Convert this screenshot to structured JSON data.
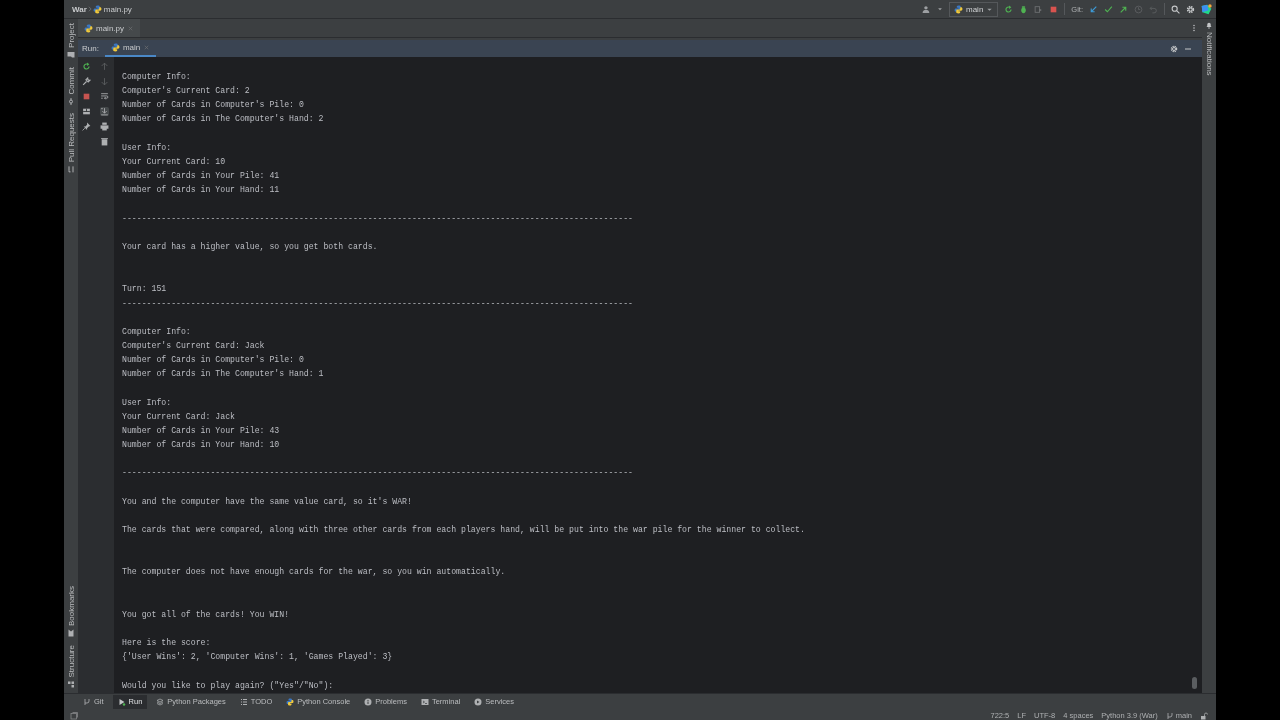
{
  "breadcrumbs": [
    "War",
    "main.py"
  ],
  "toolbar": {
    "run_config": "main",
    "git_label": "Git:"
  },
  "editor_tabs": [
    {
      "label": "main.py",
      "selected": true
    }
  ],
  "left_stripe": {
    "top": [
      "Project",
      "Commit",
      "Pull Requests"
    ],
    "bottom": [
      "Bookmarks",
      "Structure"
    ]
  },
  "right_stripe": [
    "Notifications"
  ],
  "run_panel": {
    "label": "Run:",
    "tabs": [
      {
        "label": "main",
        "selected": true
      }
    ]
  },
  "console": [
    {
      "kind": "text",
      "text": "Computer Info:"
    },
    {
      "kind": "text",
      "text": "Computer's Current Card: 2"
    },
    {
      "kind": "text",
      "text": "Number of Cards in Computer's Pile: 0"
    },
    {
      "kind": "text",
      "text": "Number of Cards in The Computer's Hand: 2"
    },
    {
      "kind": "blank"
    },
    {
      "kind": "text",
      "text": "User Info:"
    },
    {
      "kind": "text",
      "text": "Your Current Card: 10"
    },
    {
      "kind": "text",
      "text": "Number of Cards in Your Pile: 41"
    },
    {
      "kind": "text",
      "text": "Number of Cards in Your Hand: 11"
    },
    {
      "kind": "blank"
    },
    {
      "kind": "text",
      "text": "--------------------------------------------------------------------------------------------------------"
    },
    {
      "kind": "blank"
    },
    {
      "kind": "text",
      "text": "Your card has a higher value, so you get both cards."
    },
    {
      "kind": "blank"
    },
    {
      "kind": "blank"
    },
    {
      "kind": "text",
      "text": "Turn: 151"
    },
    {
      "kind": "text",
      "text": "--------------------------------------------------------------------------------------------------------"
    },
    {
      "kind": "blank"
    },
    {
      "kind": "text",
      "text": "Computer Info:"
    },
    {
      "kind": "text",
      "text": "Computer's Current Card: Jack"
    },
    {
      "kind": "text",
      "text": "Number of Cards in Computer's Pile: 0"
    },
    {
      "kind": "text",
      "text": "Number of Cards in The Computer's Hand: 1"
    },
    {
      "kind": "blank"
    },
    {
      "kind": "text",
      "text": "User Info:"
    },
    {
      "kind": "text",
      "text": "Your Current Card: Jack"
    },
    {
      "kind": "text",
      "text": "Number of Cards in Your Pile: 43"
    },
    {
      "kind": "text",
      "text": "Number of Cards in Your Hand: 10"
    },
    {
      "kind": "blank"
    },
    {
      "kind": "text",
      "text": "--------------------------------------------------------------------------------------------------------"
    },
    {
      "kind": "blank"
    },
    {
      "kind": "text",
      "text": "You and the computer have the same value card, so it's WAR!"
    },
    {
      "kind": "blank"
    },
    {
      "kind": "text",
      "text": "The cards that were compared, along with three other cards from each players hand, will be put into the war pile for the winner to collect."
    },
    {
      "kind": "blank"
    },
    {
      "kind": "blank"
    },
    {
      "kind": "text",
      "text": "The computer does not have enough cards for the war, so you win automatically."
    },
    {
      "kind": "blank"
    },
    {
      "kind": "blank"
    },
    {
      "kind": "text",
      "text": "You got all of the cards! You WIN!"
    },
    {
      "kind": "blank"
    },
    {
      "kind": "text",
      "text": "Here is the score:"
    },
    {
      "kind": "text",
      "text": "{'User Wins': 2, 'Computer Wins': 1, 'Games Played': 3}"
    },
    {
      "kind": "blank"
    },
    {
      "kind": "text",
      "text": "Would you like to play again? (\"Yes\"/\"No\"):"
    }
  ],
  "tool_windows": [
    {
      "kind": "git",
      "label": "Git",
      "selected": false
    },
    {
      "kind": "run",
      "label": "Run",
      "selected": true
    },
    {
      "kind": "packages",
      "label": "Python Packages",
      "selected": false
    },
    {
      "kind": "todo",
      "label": "TODO",
      "selected": false
    },
    {
      "kind": "python",
      "label": "Python Console",
      "selected": false
    },
    {
      "kind": "problems",
      "label": "Problems",
      "selected": false
    },
    {
      "kind": "terminal",
      "label": "Terminal",
      "selected": false
    },
    {
      "kind": "services",
      "label": "Services",
      "selected": false
    }
  ],
  "status_bar": [
    {
      "kind": "text",
      "text": "722:5"
    },
    {
      "kind": "text",
      "text": "LF"
    },
    {
      "kind": "text",
      "text": "UTF-8"
    },
    {
      "kind": "text",
      "text": "4 spaces"
    },
    {
      "kind": "text",
      "text": "Python 3.9 (War)"
    },
    {
      "kind": "branch",
      "text": "main"
    }
  ]
}
